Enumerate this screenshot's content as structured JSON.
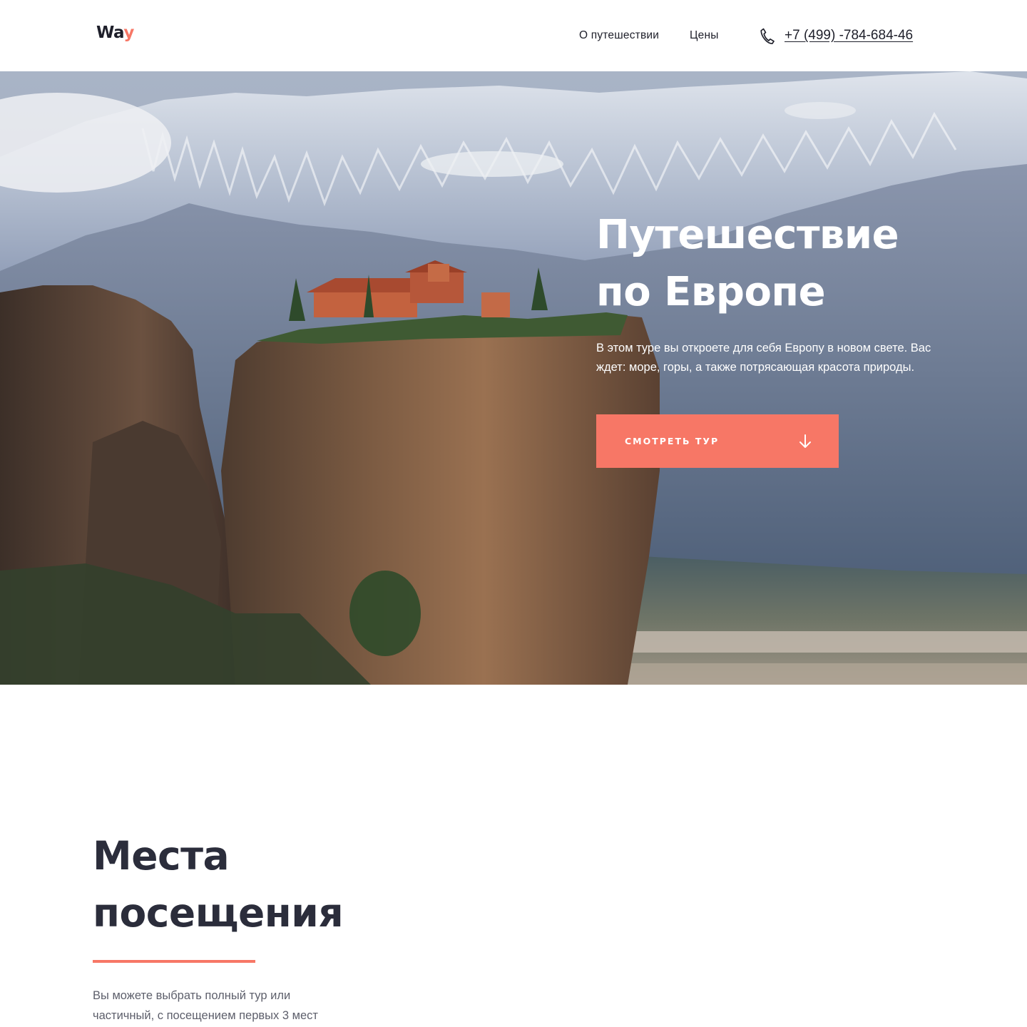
{
  "header": {
    "logo_main": "Wa",
    "logo_accent": "y",
    "nav": [
      "О путешествии",
      "Цены"
    ],
    "phone": "+7 (499) -784-684-46",
    "phone_icon": "phone-icon"
  },
  "hero": {
    "title_line1": "Путешествие",
    "title_line2": "по Европе",
    "text": "В этом туре вы откроете для себя Европу в новом свете. Вас ждет: море, горы, а также потрясающая красота природы.",
    "button_label": "СМОТРЕТЬ ТУР",
    "button_icon": "arrow-down-icon",
    "image": "mountain-monastery-photo"
  },
  "places": {
    "title_line1": "Места",
    "title_line2": "посещения",
    "text": "Вы можете выбрать полный тур или частичный, с посещением первых 3 мест"
  },
  "colors": {
    "accent": "#f77766",
    "dark": "#2b2d3b",
    "text_muted": "#5d5f6b",
    "white": "#ffffff"
  }
}
